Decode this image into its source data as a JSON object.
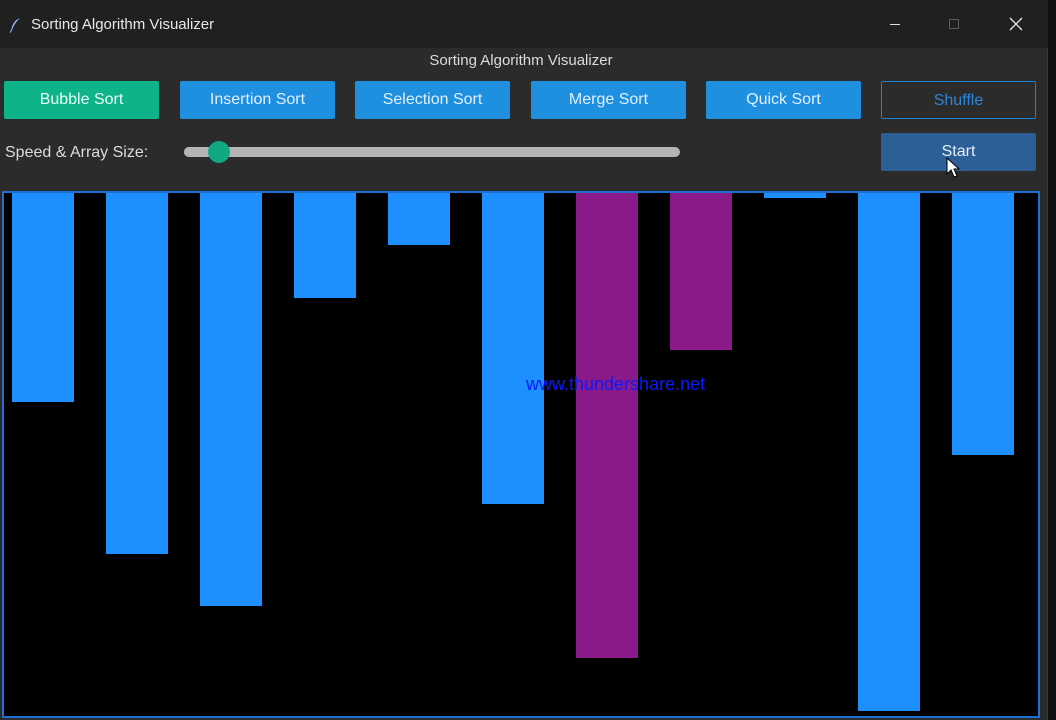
{
  "window": {
    "title": "Sorting Algorithm Visualizer",
    "app_icon": "feather-icon",
    "controls": [
      "minimize-icon",
      "maximize-icon",
      "close-icon"
    ]
  },
  "header": {
    "title": "Sorting Algorithm Visualizer"
  },
  "toolbar": {
    "bubble_sort_label": "Bubble Sort",
    "insertion_sort_label": "Insertion Sort",
    "selection_sort_label": "Selection Sort",
    "merge_sort_label": "Merge Sort",
    "quick_sort_label": "Quick Sort",
    "shuffle_label": "Shuffle",
    "start_label": "Start",
    "active_algorithm": "Bubble Sort"
  },
  "controls": {
    "speed_label": "Speed & Array Size:",
    "slider_fraction": 0.07
  },
  "colors": {
    "active_button": "#0fb38a",
    "button": "#1f8fe0",
    "bar_default": "#1e8fff",
    "bar_compare": "#8a1a8a",
    "canvas_background": "#000000",
    "canvas_border": "#1f6fd0"
  },
  "visualizer": {
    "bars": [
      {
        "value": 0.4,
        "state": "default"
      },
      {
        "value": 0.69,
        "state": "default"
      },
      {
        "value": 0.79,
        "state": "default"
      },
      {
        "value": 0.2,
        "state": "default"
      },
      {
        "value": 0.1,
        "state": "default"
      },
      {
        "value": 0.595,
        "state": "default"
      },
      {
        "value": 0.89,
        "state": "compare"
      },
      {
        "value": 0.3,
        "state": "compare"
      },
      {
        "value": 0.01,
        "state": "default"
      },
      {
        "value": 0.99,
        "state": "default"
      },
      {
        "value": 0.5,
        "state": "default"
      }
    ],
    "watermark": "www.thundershare.net"
  },
  "cursor": "pointer-cursor-icon"
}
